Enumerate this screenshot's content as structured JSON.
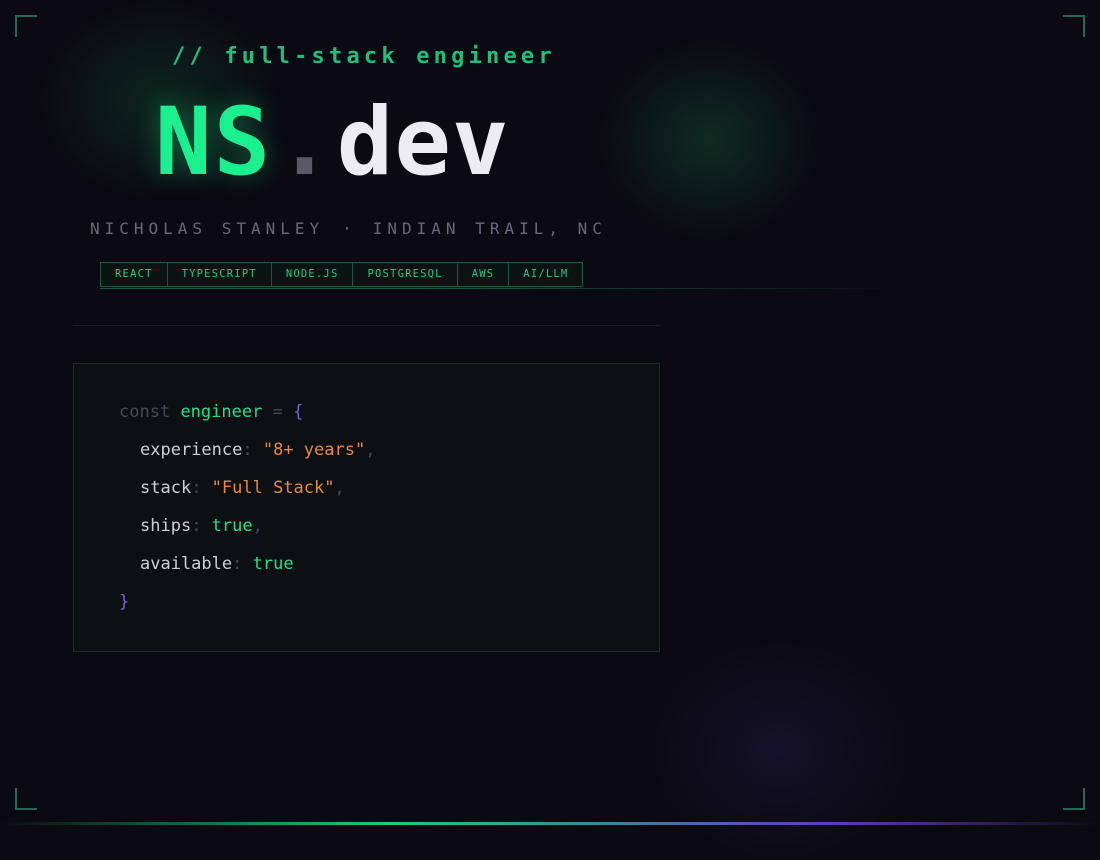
{
  "header": {
    "subtitle": "// full-stack engineer",
    "logo": {
      "primary": "NS",
      "dot": ".",
      "secondary": "dev"
    },
    "name": "NICHOLAS STANLEY",
    "separator": "·",
    "location": "INDIAN TRAIL, NC"
  },
  "tags": [
    "REACT",
    "TYPESCRIPT",
    "NODE.JS",
    "POSTGRESQL",
    "AWS",
    "AI/LLM"
  ],
  "code": {
    "keyword": "const",
    "identifier": "engineer",
    "assign": "=",
    "open_brace": "{",
    "close_brace": "}",
    "properties": [
      {
        "key": "experience",
        "value": "\"8+ years\"",
        "type": "string",
        "trailing": ","
      },
      {
        "key": "stack",
        "value": "\"Full Stack\"",
        "type": "string",
        "trailing": ","
      },
      {
        "key": "ships",
        "value": "true",
        "type": "boolean",
        "trailing": ","
      },
      {
        "key": "available",
        "value": "true",
        "type": "boolean",
        "trailing": ""
      }
    ]
  },
  "colors": {
    "background": "#0b0a12",
    "accent_green": "#1bf08f",
    "string_orange": "#e88a3e",
    "brace_purple": "#7d5fd6"
  }
}
